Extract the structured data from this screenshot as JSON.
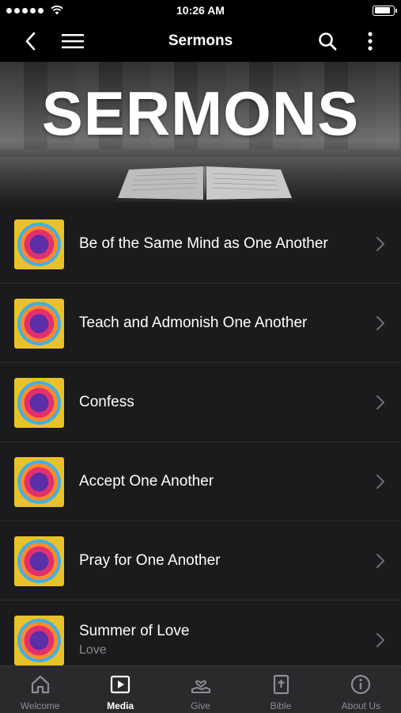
{
  "status_bar": {
    "time": "10:26 AM",
    "battery_level": 0.9
  },
  "nav": {
    "title": "Sermons"
  },
  "banner": {
    "title": "SERMONS"
  },
  "thumbnail_icon": "summer-of-love-artwork",
  "sermons": [
    {
      "title": "Be of the Same Mind as One Another",
      "subtitle": ""
    },
    {
      "title": "Teach and Admonish One Another",
      "subtitle": ""
    },
    {
      "title": "Confess",
      "subtitle": ""
    },
    {
      "title": "Accept One Another",
      "subtitle": ""
    },
    {
      "title": "Pray for One Another",
      "subtitle": ""
    },
    {
      "title": "Summer of Love",
      "subtitle": "Love"
    }
  ],
  "tabs": [
    {
      "label": "Welcome",
      "icon": "home-icon",
      "active": false
    },
    {
      "label": "Media",
      "icon": "play-icon",
      "active": true
    },
    {
      "label": "Give",
      "icon": "give-hand-icon",
      "active": false
    },
    {
      "label": "Bible",
      "icon": "bible-icon",
      "active": false
    },
    {
      "label": "About Us",
      "icon": "info-icon",
      "active": false
    }
  ],
  "colors": {
    "background": "#1b1b1d",
    "bar": "#000000",
    "tab_bar": "#2a2a2d",
    "muted_text": "#8b8b8f"
  }
}
